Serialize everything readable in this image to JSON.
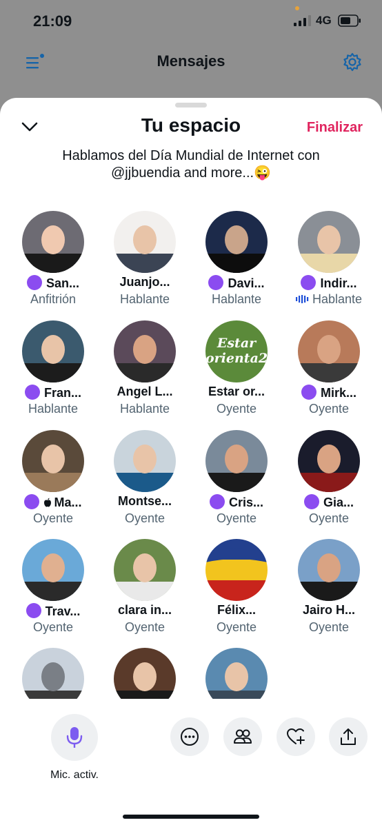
{
  "status": {
    "time": "21:09",
    "network": "4G"
  },
  "nav": {
    "title": "Mensajes"
  },
  "sheet": {
    "title": "Tu espacio",
    "end_label": "Finalizar",
    "topic": "Hablamos del Día Mundial de Internet con @jjbuendia and more...😜"
  },
  "participants": [
    {
      "name": "San...",
      "role": "Anfitrión",
      "dot": true
    },
    {
      "name": "Juanjo...",
      "role": "Hablante"
    },
    {
      "name": "Davi...",
      "role": "Hablante",
      "dot": true
    },
    {
      "name": "Indir...",
      "role": "Hablante",
      "dot": true,
      "speaking": true
    },
    {
      "name": "Fran...",
      "role": "Hablante",
      "dot": true
    },
    {
      "name": "Angel L...",
      "role": "Hablante"
    },
    {
      "name": "Estar or...",
      "role": "Oyente",
      "avatar_text": [
        "Estar",
        "orienta2"
      ]
    },
    {
      "name": "Mirk...",
      "role": "Oyente",
      "dot": true
    },
    {
      "name": "Ma...",
      "role": "Oyente",
      "dot": true,
      "apple": true
    },
    {
      "name": "Montse...",
      "role": "Oyente"
    },
    {
      "name": "Cris...",
      "role": "Oyente",
      "dot": true
    },
    {
      "name": "Gia...",
      "role": "Oyente",
      "dot": true
    },
    {
      "name": "Trav...",
      "role": "Oyente",
      "dot": true
    },
    {
      "name": "clara in...",
      "role": "Oyente"
    },
    {
      "name": "Félix...",
      "role": "Oyente"
    },
    {
      "name": "Jairo H...",
      "role": "Oyente"
    },
    {
      "name": "",
      "role": ""
    },
    {
      "name": "",
      "role": ""
    },
    {
      "name": "",
      "role": ""
    }
  ],
  "controls": {
    "mic_label": "Mic. activ."
  },
  "colors": {
    "accent": "#1d9bf0",
    "end": "#e0245e",
    "badge": "#8b4cf0",
    "mic": "#7c5cf0"
  },
  "icons": [
    "menu-icon",
    "gear-icon",
    "chevron-down-icon",
    "microphone-icon",
    "more-icon",
    "people-icon",
    "heart-plus-icon",
    "share-icon"
  ]
}
